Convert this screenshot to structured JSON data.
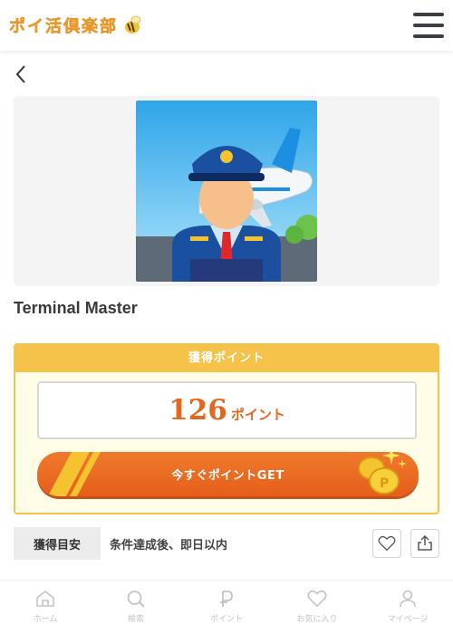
{
  "header": {
    "logo_text": "ポイ活倶楽部",
    "logo_icon": "bee-icon",
    "menu_icon": "hamburger-menu-icon"
  },
  "nav": {
    "back_icon": "chevron-left-icon"
  },
  "app": {
    "title": "Terminal Master",
    "image_icon": "pilot-airplane-app-image"
  },
  "point_card": {
    "header_label": "獲得ポイント",
    "points": "126",
    "unit": "ポイント",
    "cta_label": "今すぐポイントGET",
    "coin_icon": "coins-sparkle-icon"
  },
  "estimate": {
    "tag_label": "獲得目安",
    "text": "条件達成後、即日以内",
    "favorite_icon": "heart-icon",
    "share_icon": "share-icon"
  },
  "tabbar": {
    "items": [
      {
        "label": "ホーム",
        "icon": "home-icon"
      },
      {
        "label": "検索",
        "icon": "search-icon"
      },
      {
        "label": "ポイント",
        "icon": "point-p-icon"
      },
      {
        "label": "お気に入り",
        "icon": "heart-icon"
      },
      {
        "label": "マイページ",
        "icon": "user-icon"
      }
    ]
  },
  "colors": {
    "accent_yellow": "#f5c34a",
    "accent_orange": "#e2681f",
    "button_orange": "#ef7a2b",
    "tab_inactive": "#c4c4c4"
  }
}
